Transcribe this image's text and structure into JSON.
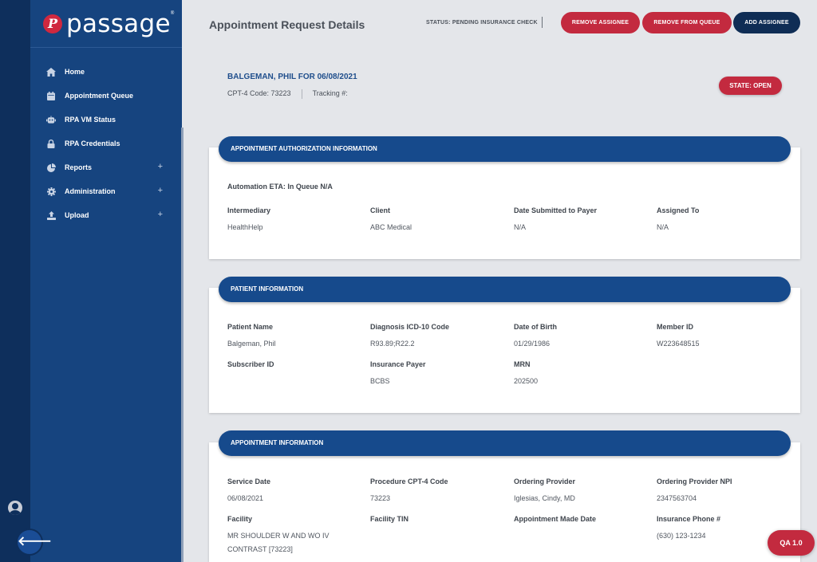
{
  "brand": {
    "name": "passage",
    "mark": "P",
    "tm": "®"
  },
  "sidebar": {
    "items": [
      {
        "label": "Home",
        "icon": "home-icon"
      },
      {
        "label": "Appointment Queue",
        "icon": "calendar-icon"
      },
      {
        "label": "RPA VM Status",
        "icon": "robot-icon"
      },
      {
        "label": "RPA Credentials",
        "icon": "lock-icon"
      },
      {
        "label": "Reports",
        "icon": "pie-chart-icon",
        "expand": "+"
      },
      {
        "label": "Administration",
        "icon": "gear-icon",
        "expand": "+"
      },
      {
        "label": "Upload",
        "icon": "upload-icon",
        "expand": "+"
      }
    ]
  },
  "rail": {
    "back_symbol": "🡐"
  },
  "header": {
    "title": "Appointment Request Details",
    "status": "STATUS: PENDING INSURANCE CHECK",
    "buttons": {
      "remove_assignee": "REMOVE ASSIGNEE",
      "remove_from_queue": "REMOVE FROM QUEUE",
      "add_assignee": "ADD ASSIGNEE"
    }
  },
  "summary": {
    "title": "BALGEMAN, PHIL FOR 06/08/2021",
    "cpt": "CPT-4 Code: 73223",
    "tracking": "Tracking #:",
    "state": "STATE: OPEN"
  },
  "authorization": {
    "heading": "APPOINTMENT AUTHORIZATION INFORMATION",
    "eta": "Automation ETA: In Queue N/A",
    "fields": [
      {
        "label": "Intermediary",
        "value": "HealthHelp"
      },
      {
        "label": "Client",
        "value": "ABC Medical"
      },
      {
        "label": "Date Submitted to Payer",
        "value": "N/A"
      },
      {
        "label": "Assigned To",
        "value": "N/A"
      }
    ]
  },
  "patient": {
    "heading": "PATIENT INFORMATION",
    "fields": [
      {
        "label": "Patient Name",
        "value": "Balgeman, Phil"
      },
      {
        "label": "Diagnosis ICD-10 Code",
        "value": "R93.89;R22.2"
      },
      {
        "label": "Date of Birth",
        "value": "01/29/1986"
      },
      {
        "label": "Member ID",
        "value": "W223648515"
      },
      {
        "label": "Subscriber ID",
        "value": ""
      },
      {
        "label": "Insurance Payer",
        "value": "BCBS"
      },
      {
        "label": "MRN",
        "value": "202500"
      }
    ]
  },
  "appointment": {
    "heading": "APPOINTMENT INFORMATION",
    "fields": [
      {
        "label": "Service Date",
        "value": "06/08/2021"
      },
      {
        "label": "Procedure CPT-4 Code",
        "value": "73223"
      },
      {
        "label": "Ordering Provider",
        "value": "Iglesias, Cindy, MD"
      },
      {
        "label": "Ordering Provider NPI",
        "value": "2347563704"
      },
      {
        "label": "Facility",
        "value": "MR SHOULDER W AND WO IV CONTRAST [73223]"
      },
      {
        "label": "Facility TIN",
        "value": ""
      },
      {
        "label": "Appointment Made Date",
        "value": ""
      },
      {
        "label": "Insurance Phone #",
        "value": "(630) 123-1234"
      }
    ]
  },
  "footer": {
    "qa": "QA 1.0"
  }
}
